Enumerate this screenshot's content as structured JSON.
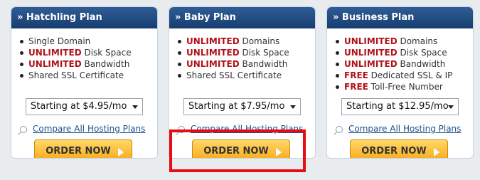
{
  "plans": [
    {
      "title": "» Hatchling Plan",
      "features": [
        {
          "hl": "",
          "text": "Single Domain"
        },
        {
          "hl": "UNLIMITED",
          "text": " Disk Space"
        },
        {
          "hl": "UNLIMITED",
          "text": " Bandwidth"
        },
        {
          "hl": "",
          "text": "Shared SSL Certificate"
        }
      ],
      "price_select": "Starting at $4.95/mo",
      "compare_link": "Compare All Hosting Plans",
      "order_button": "ORDER NOW"
    },
    {
      "title": "» Baby Plan",
      "features": [
        {
          "hl": "UNLIMITED",
          "text": " Domains"
        },
        {
          "hl": "UNLIMITED",
          "text": " Disk Space"
        },
        {
          "hl": "UNLIMITED",
          "text": " Bandwidth"
        },
        {
          "hl": "",
          "text": "Shared SSL Certificate"
        }
      ],
      "price_select": "Starting at $7.95/mo",
      "compare_link": "Compare All Hosting Plans",
      "order_button": "ORDER NOW"
    },
    {
      "title": "» Business Plan",
      "features": [
        {
          "hl": "UNLIMITED",
          "text": " Domains"
        },
        {
          "hl": "UNLIMITED",
          "text": " Disk Space"
        },
        {
          "hl": "UNLIMITED",
          "text": " Bandwidth"
        },
        {
          "hl": "FREE",
          "text": " Dedicated SSL & IP"
        },
        {
          "hl": "FREE",
          "text": " Toll-Free Number"
        }
      ],
      "price_select": "Starting at $12.95/mo",
      "compare_link": "Compare All Hosting Plans",
      "order_button": "ORDER NOW"
    }
  ],
  "colors": {
    "header_bg": "#234c83",
    "highlight_text": "#b1121a",
    "button_gradient_top": "#ffd86a",
    "button_gradient_bottom": "#f8a40f",
    "highlight_box": "#e60b14"
  }
}
